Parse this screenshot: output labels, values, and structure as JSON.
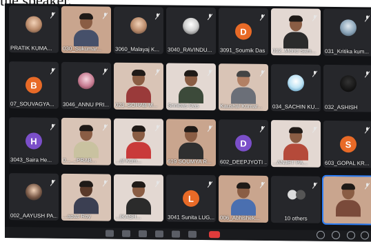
{
  "caption": "the speaker.",
  "colors": {
    "orange": "#e86a27",
    "purple": "#7b4fc9",
    "green_avatar": "#3f8f3a"
  },
  "tiles": [
    {
      "name": "PRATIK KUMA..."
    },
    {
      "name": "030_Sukumar..."
    },
    {
      "name": "3060_Malayaj K..."
    },
    {
      "name": "3040_RAVINDU..."
    },
    {
      "name": "3091_Soumik Das",
      "avatar": "D"
    },
    {
      "name": "012_Mohd Sam..."
    },
    {
      "name": "031_Kritika kum..."
    },
    {
      "name": "07_SOUVAGYA...",
      "avatar": "B"
    },
    {
      "name": "3046_ANNU PRI..."
    },
    {
      "name": "023_SOHAB M..."
    },
    {
      "name": "Srinibas Das"
    },
    {
      "name": "Kaushal Kumar..."
    },
    {
      "name": "034_SACHIN KU..."
    },
    {
      "name": "032_ASHISH"
    },
    {
      "name": "3043_Saira He...",
      "avatar": "H"
    },
    {
      "name": "0..._..PRAB..."
    },
    {
      "name": "...al Kum..."
    },
    {
      "name": "619 SOUMYA R..."
    },
    {
      "name": "602_DEEPJYOTI ...",
      "avatar": "D"
    },
    {
      "name": "...ANJET PA..."
    },
    {
      "name": "603_GOPAL KR...",
      "avatar": "S"
    },
    {
      "name": "002_AAYUSH PA..."
    },
    {
      "name": "...apas Roy"
    },
    {
      "name": "...IKASH..."
    },
    {
      "name": "3041 Sunita LUG...",
      "avatar": "L"
    },
    {
      "name": "006_Abhishek..."
    },
    {
      "name": "10 others"
    },
    {
      "name": ""
    }
  ]
}
